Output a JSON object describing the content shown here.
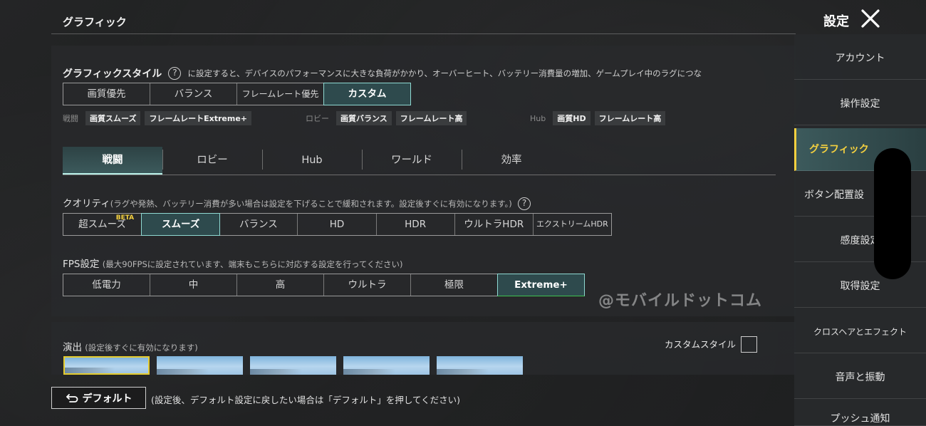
{
  "header": {
    "page_title": "グラフィック",
    "settings_title": "設定",
    "close_icon": "close-icon"
  },
  "graphics_style": {
    "label": "グラフィックスタイル",
    "help_icon": "question-icon",
    "description": "に設定すると、デバイスのパフォーマンスに大きな負荷がかかり、オーバーヒート、バッテリー消費量の増加、ゲームプレイ中のラグにつな",
    "options": [
      "画質優先",
      "バランス",
      "フレームレート優先",
      "カスタム"
    ],
    "selected": "カスタム"
  },
  "presets": {
    "battle": {
      "label": "戦闘",
      "quality": "画質スムーズ",
      "fps": "フレームレートExtreme+"
    },
    "lobby": {
      "label": "ロビー",
      "quality": "画質バランス",
      "fps": "フレームレート高"
    },
    "hub": {
      "label": "Hub",
      "quality": "画質HD",
      "fps": "フレームレート高"
    }
  },
  "tabs": [
    "戦闘",
    "ロビー",
    "Hub",
    "ワールド",
    "効率"
  ],
  "tab_selected": "戦闘",
  "quality": {
    "label": "クオリティ",
    "note": "(ラグや発熱、バッテリー消費が多い場合は設定を下げることで緩和されます。設定後すぐに有効になります。)",
    "help_icon": "question-icon",
    "options": [
      "超スムーズ",
      "スムーズ",
      "バランス",
      "HD",
      "HDR",
      "ウルトラHDR",
      "エクストリームHDR"
    ],
    "beta_badge": "BETA",
    "selected": "スムーズ"
  },
  "fps": {
    "label": "FPS設定",
    "note": "(最大90FPSに設定されています、端末もこちらに対応する設定を行ってください)",
    "options": [
      "低電力",
      "中",
      "高",
      "ウルトラ",
      "極限",
      "Extreme+"
    ],
    "selected": "Extreme+"
  },
  "watermark": "@モバイルドットコム",
  "effects": {
    "label": "演出",
    "note": "(設定後すぐに有効になります)",
    "custom_style_label": "カスタムスタイル",
    "thumbnail_count": 5,
    "selected_index": 0
  },
  "footer": {
    "default_label": "デフォルト",
    "default_icon": "undo-arrow-icon",
    "default_note": "(設定後、デフォルト設定に戻したい場合は「デフォルト」を押してください)"
  },
  "sidebar": {
    "items": [
      "アカウント",
      "操作設定",
      "グラフィック",
      "ボタン配置設",
      "感度設定",
      "取得設定",
      "クロスヘアとエフェクト",
      "音声と振動",
      "プッシュ通知"
    ],
    "selected": "グラフィック"
  },
  "colors": {
    "accent_teal": "#8fd9d2",
    "selected_gold": "#f4d03f"
  }
}
